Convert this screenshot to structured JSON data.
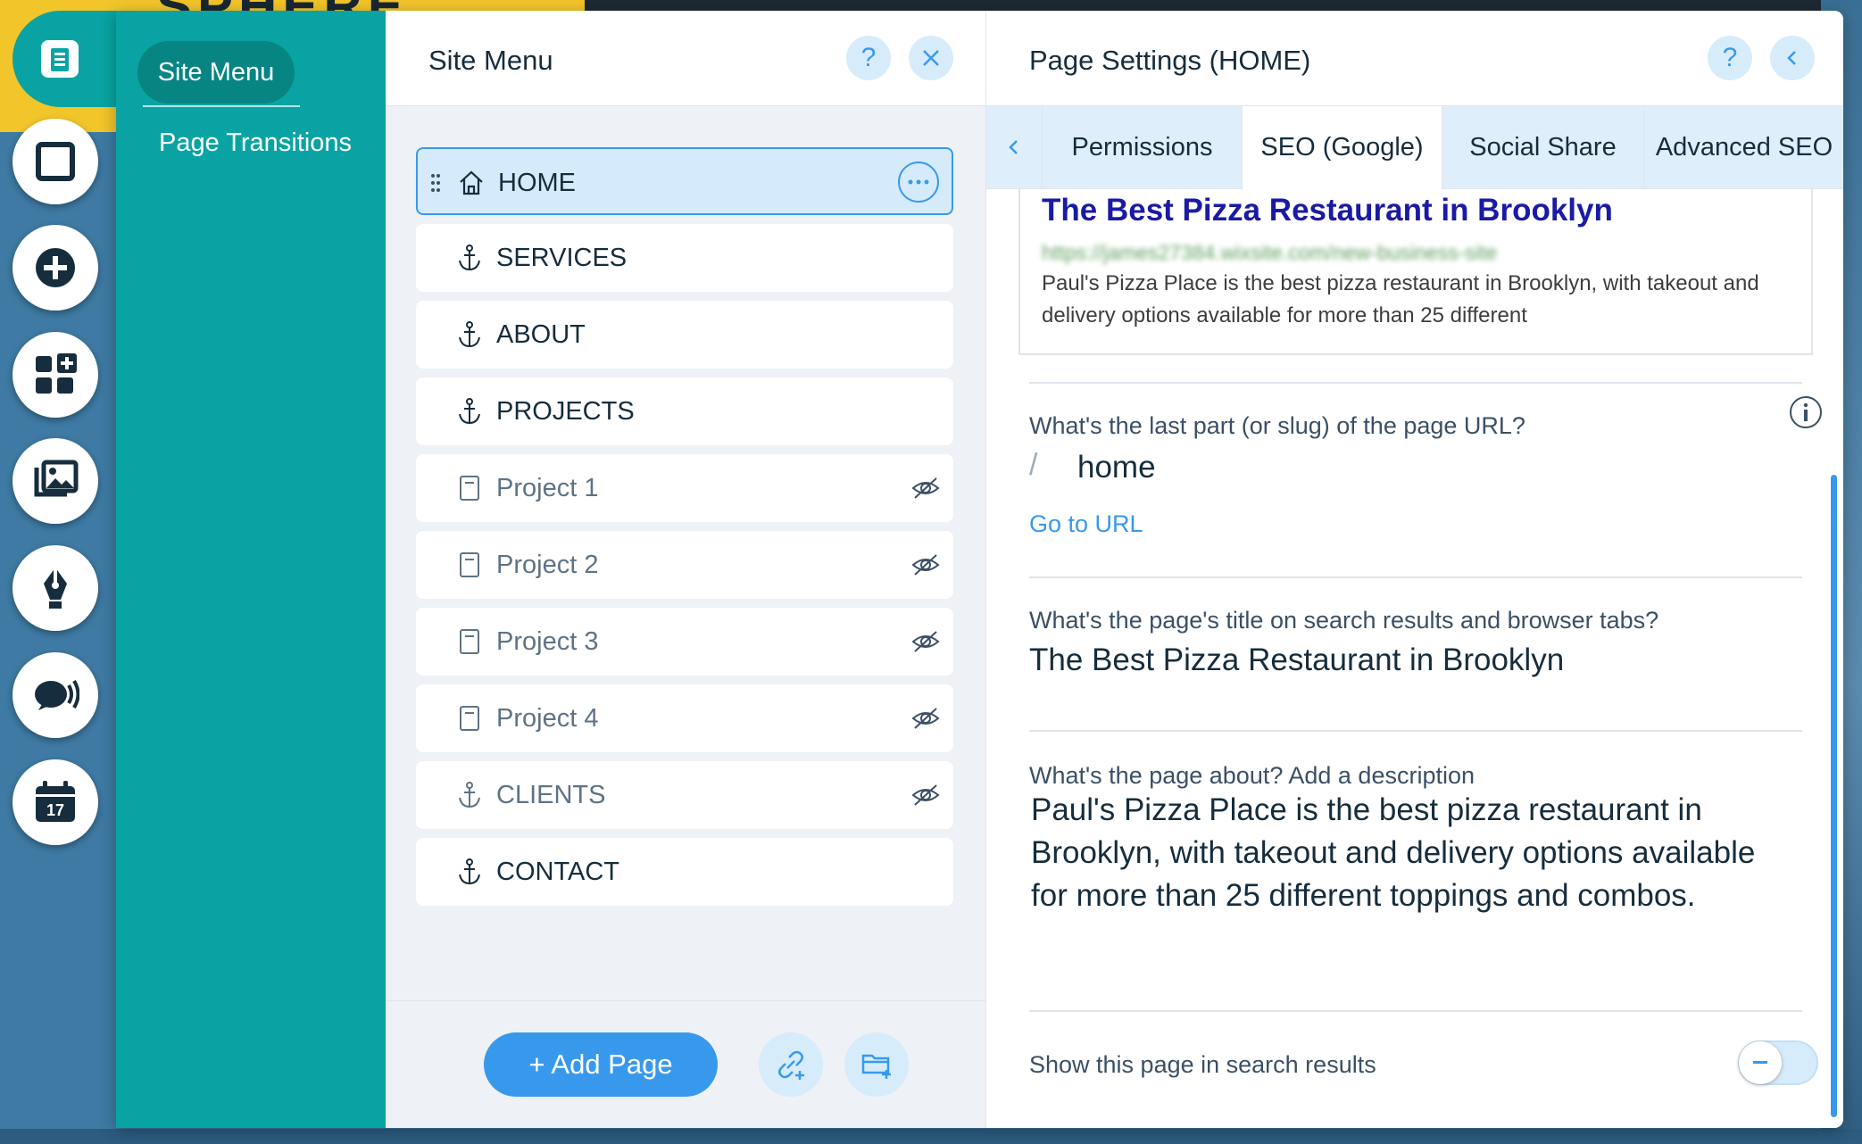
{
  "background": {
    "brand_fragment": "SPHERE"
  },
  "toolbar": {
    "items": [
      {
        "name": "pages-icon"
      },
      {
        "name": "background-icon"
      },
      {
        "name": "add-icon"
      },
      {
        "name": "add-apps-icon"
      },
      {
        "name": "media-icon"
      },
      {
        "name": "blog-pen-icon"
      },
      {
        "name": "chat-icon"
      },
      {
        "name": "bookings-calendar-icon",
        "label": "17"
      }
    ]
  },
  "nav": {
    "active": "Site Menu",
    "items": [
      "Page Transitions"
    ]
  },
  "site_menu": {
    "title": "Site Menu",
    "help": "?",
    "pages": [
      {
        "label": "HOME",
        "type": "home",
        "selected": true,
        "hidden": false
      },
      {
        "label": "SERVICES",
        "type": "anchor",
        "selected": false,
        "hidden": false
      },
      {
        "label": "ABOUT",
        "type": "anchor",
        "selected": false,
        "hidden": false
      },
      {
        "label": "PROJECTS",
        "type": "anchor",
        "selected": false,
        "hidden": false
      },
      {
        "label": "Project 1",
        "type": "page",
        "selected": false,
        "hidden": true
      },
      {
        "label": "Project 2",
        "type": "page",
        "selected": false,
        "hidden": true
      },
      {
        "label": "Project 3",
        "type": "page",
        "selected": false,
        "hidden": true
      },
      {
        "label": "Project 4",
        "type": "page",
        "selected": false,
        "hidden": true
      },
      {
        "label": "CLIENTS",
        "type": "anchor",
        "selected": false,
        "hidden": true
      },
      {
        "label": "CONTACT",
        "type": "anchor",
        "selected": false,
        "hidden": false
      }
    ],
    "add_page_label": "+ Add Page"
  },
  "page_settings": {
    "title": "Page Settings (HOME)",
    "help": "?",
    "tabs": [
      {
        "label": "Permissions",
        "active": false
      },
      {
        "label": "SEO (Google)",
        "active": true
      },
      {
        "label": "Social Share",
        "active": false
      },
      {
        "label": "Advanced SEO",
        "active": false
      }
    ],
    "preview": {
      "title": "The Best Pizza Restaurant in Brooklyn",
      "url": "https://james27384.wixsite.com/new-business-site",
      "description": "Paul's Pizza Place is the best pizza restaurant in Brooklyn, with takeout and delivery options available for more than 25 different"
    },
    "slug": {
      "question": "What's the last part (or slug) of the page URL?",
      "slash": "/",
      "value": "home",
      "go_to_url": "Go to URL"
    },
    "seo_title": {
      "question": "What's the page's title on search results and browser tabs?",
      "value": "The Best Pizza Restaurant in Brooklyn"
    },
    "seo_description": {
      "question": "What's the page about? Add a description",
      "value": "Paul's Pizza Place is the best pizza restaurant in Brooklyn, with takeout and delivery options available for more than 25 different toppings and combos."
    },
    "show_in_search": {
      "label": "Show this page in search results",
      "enabled": false
    }
  },
  "colors": {
    "accent": "#3899ec",
    "nav_teal": "#0aa3a3",
    "text_dark": "#162d3d"
  }
}
